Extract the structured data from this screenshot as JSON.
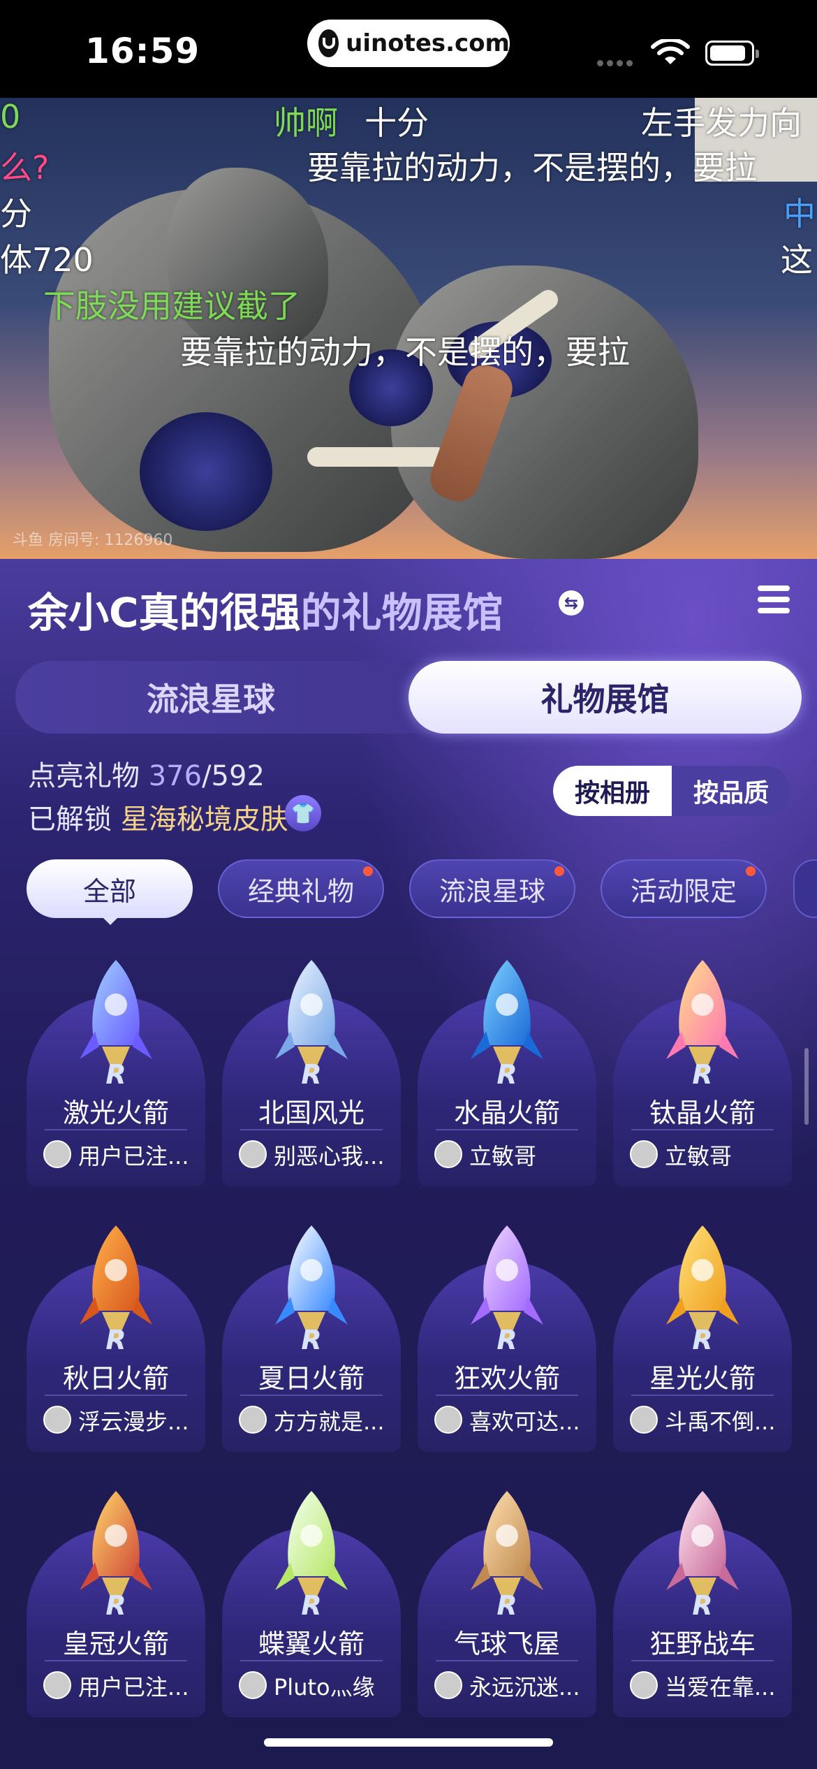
{
  "status_bar": {
    "time": "16:59",
    "url": "uinotes.com"
  },
  "stream": {
    "watermark": "斗鱼 房间号: 1126960",
    "danmaku": [
      {
        "text": "0",
        "color": "#7ed957"
      },
      {
        "text": "帅啊",
        "color": "#7ed957"
      },
      {
        "text": "十分",
        "color": "#ffffff"
      },
      {
        "text": "左手发力向",
        "color": "#ffffff"
      },
      {
        "text": "么?",
        "color": "#ff4a8a"
      },
      {
        "text": "要靠拉的动力，不是摆的，要拉",
        "color": "#ffffff"
      },
      {
        "text": "分",
        "color": "#ffffff"
      },
      {
        "text": "中",
        "color": "#4aa0ff"
      },
      {
        "text": "体720",
        "color": "#ffffff"
      },
      {
        "text": "这",
        "color": "#ffffff"
      },
      {
        "text": "下肢没用建议截了",
        "color": "#7ed957"
      },
      {
        "text": "要靠拉的动力，不是摆的，要拉",
        "color": "#ffffff"
      }
    ]
  },
  "header": {
    "title_name": "余小C真的很强",
    "title_suffix": "的礼物展馆",
    "swap_glyph": "⇆"
  },
  "tabs": [
    {
      "label": "流浪星球"
    },
    {
      "label": "礼物展馆"
    }
  ],
  "stats": {
    "label": "点亮礼物",
    "lit": "376",
    "total": "/592"
  },
  "unlock": {
    "label": "已解锁",
    "skin": "星海秘境皮肤"
  },
  "sort": {
    "by_album": "按相册",
    "by_quality": "按品质"
  },
  "chips": [
    {
      "label": "全部",
      "active": true
    },
    {
      "label": "经典礼物",
      "dot": true
    },
    {
      "label": "流浪星球",
      "dot": true
    },
    {
      "label": "活动限定",
      "dot": true
    }
  ],
  "gifts": [
    {
      "name": "激光火箭",
      "user": "用户已注...",
      "colors": [
        "#9fd0ff",
        "#6a5cff"
      ]
    },
    {
      "name": "北国风光",
      "user": "别恶心我...",
      "colors": [
        "#eaf4ff",
        "#7aa8e8"
      ]
    },
    {
      "name": "水晶火箭",
      "user": "立敏哥",
      "colors": [
        "#7ed0ff",
        "#1a6bd8"
      ]
    },
    {
      "name": "钛晶火箭",
      "user": "立敏哥",
      "colors": [
        "#ffe08a",
        "#ff7ab0"
      ]
    },
    {
      "name": "秋日火箭",
      "user": "浮云漫步...",
      "colors": [
        "#ffb24a",
        "#d8571c"
      ]
    },
    {
      "name": "夏日火箭",
      "user": "方方就是...",
      "colors": [
        "#ffffff",
        "#3a8aff"
      ]
    },
    {
      "name": "狂欢火箭",
      "user": "喜欢可达...",
      "colors": [
        "#f0d8ff",
        "#a36bff"
      ]
    },
    {
      "name": "星光火箭",
      "user": "斗禹不倒...",
      "colors": [
        "#ffe27a",
        "#f0a020"
      ]
    },
    {
      "name": "皇冠火箭",
      "user": "用户已注...",
      "colors": [
        "#ffd86a",
        "#d04a3a"
      ]
    },
    {
      "name": "蝶翼火箭",
      "user": "Pluto灬缘",
      "colors": [
        "#f4fff0",
        "#b8e86a"
      ]
    },
    {
      "name": "气球飞屋",
      "user": "永远沉迷...",
      "colors": [
        "#ffe0b0",
        "#c08a50"
      ]
    },
    {
      "name": "狂野战车",
      "user": "当爱在靠...",
      "colors": [
        "#ffe6f0",
        "#c86a9a"
      ]
    }
  ]
}
